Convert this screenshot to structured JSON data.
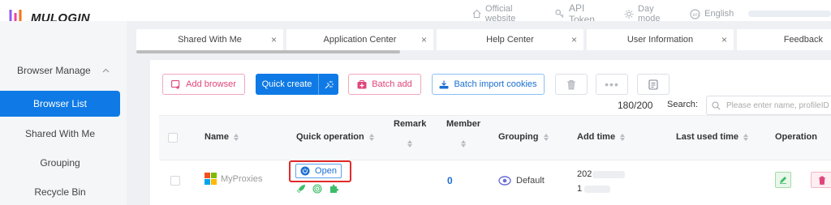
{
  "app": {
    "logo_text": "MULOGIN"
  },
  "topnav": {
    "official_website": "Official website",
    "api_token": "API Token",
    "day_mode": "Day mode",
    "language": "English"
  },
  "sidebar": {
    "group": "Browser Manage",
    "items": [
      {
        "label": "Browser List",
        "active": true
      },
      {
        "label": "Shared With Me",
        "active": false
      },
      {
        "label": "Grouping",
        "active": false
      },
      {
        "label": "Recycle Bin",
        "active": false
      }
    ]
  },
  "tabs": [
    {
      "label": "Shared With Me"
    },
    {
      "label": "Application Center"
    },
    {
      "label": "Help Center"
    },
    {
      "label": "User Information"
    },
    {
      "label": "Feedback"
    }
  ],
  "toolbar": {
    "add_browser": "Add browser",
    "quick_create": "Quick create",
    "batch_add": "Batch add",
    "batch_import": "Batch import cookies"
  },
  "list": {
    "count": "180/200",
    "search_label": "Search:",
    "search_placeholder": "Please enter name, profileID"
  },
  "table": {
    "headers": {
      "name": "Name",
      "quick_operation": "Quick operation",
      "remark": "Remark",
      "member": "Member",
      "grouping": "Grouping",
      "add_time": "Add time",
      "last_used_time": "Last used time",
      "operation": "Operation"
    },
    "rows": [
      {
        "name": "MyProxies",
        "open_label": "Open",
        "member": "0",
        "grouping": "Default",
        "add_time_line1": "202",
        "add_time_line2": "1"
      }
    ]
  },
  "colors": {
    "accent": "#0f7ae5",
    "pink": "#e0457b",
    "highlight": "#e02b2b",
    "green": "#3dbd67"
  }
}
